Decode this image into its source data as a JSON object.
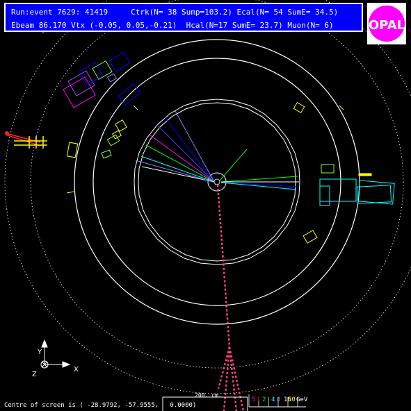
{
  "header": {
    "line1": "Run:event 7629: 41419     Ctrk(N= 38 Sump=103.2) Ecal(N= 54 SumE= 34.5)",
    "line2": "Ebeam 86.170 Vtx (-0.05, 0.05,-0.21)  Hcal(N=17 SumE= 23.7) Muon(N= 6)"
  },
  "logo": {
    "text": "OPAL"
  },
  "axes": {
    "y": "Y",
    "x": "X",
    "z": "Z"
  },
  "footer": {
    "centre": "Centre of screen is ( -28.9792, -57.9555,   0.0000)",
    "scale": "200. cm.",
    "energy_labels": [
      "5",
      "1",
      "2",
      "4",
      "8",
      "16",
      "50",
      "GeV"
    ]
  },
  "colors": {
    "background": "#000000",
    "panel": "#0000ff",
    "logo_fill": "#ff00ff",
    "muon": "#ff4488",
    "ecal": "#ffff00",
    "hcal": "#00ffff"
  }
}
